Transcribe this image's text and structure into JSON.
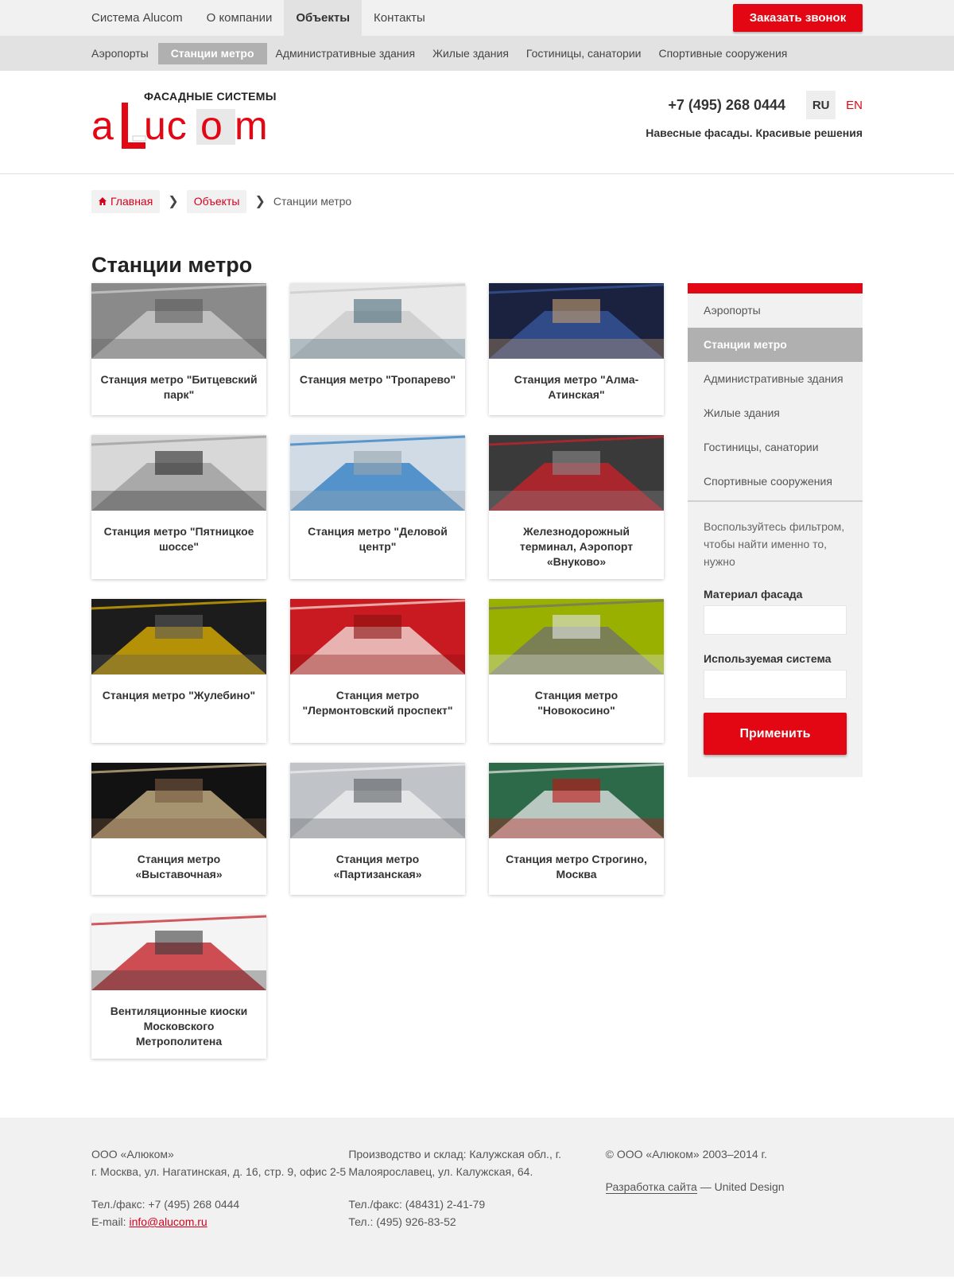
{
  "topnav": {
    "items": [
      {
        "label": "Система Alucom",
        "active": false
      },
      {
        "label": "О компании",
        "active": false
      },
      {
        "label": "Объекты",
        "active": true
      },
      {
        "label": "Контакты",
        "active": false
      }
    ],
    "call_button": "Заказать звонок"
  },
  "subnav": {
    "items": [
      {
        "label": "Аэропорты",
        "active": false
      },
      {
        "label": "Станции метро",
        "active": true
      },
      {
        "label": "Административные здания",
        "active": false
      },
      {
        "label": "Жилые здания",
        "active": false
      },
      {
        "label": "Гостиницы, санатории",
        "active": false
      },
      {
        "label": "Спортивные сооружения",
        "active": false
      }
    ]
  },
  "header": {
    "logo_subtitle": "ФАСАДНЫЕ СИСТЕМЫ",
    "logo_text": "aLucom",
    "phone": "+7 (495) 268 0444",
    "lang_ru": "RU",
    "lang_en": "EN",
    "slogan": "Навесные фасады. Красивые решения"
  },
  "breadcrumb": {
    "home": "Главная",
    "objects": "Объекты",
    "current": "Станции метро"
  },
  "page_title": "Станции метро",
  "cards": [
    {
      "title": "Станция метро \"Битцевский парк\"",
      "palette": [
        "#8a8a8a",
        "#d0d0d0",
        "#5c5c5c"
      ]
    },
    {
      "title": "Станция метро \"Тропарево\"",
      "palette": [
        "#e8e8e8",
        "#c9c9c9",
        "#4a6a7a"
      ]
    },
    {
      "title": "Станция метро \"Алма-Атинская\"",
      "palette": [
        "#1b2240",
        "#3a5aa0",
        "#c8a070"
      ]
    },
    {
      "title": "Станция метро \"Пятницкое шоссе\"",
      "palette": [
        "#d8d8d8",
        "#9a9a9a",
        "#2a2a2a"
      ]
    },
    {
      "title": "Станция метро \"Деловой центр\"",
      "palette": [
        "#d0dbe6",
        "#2a7ac0",
        "#9aa5ad"
      ]
    },
    {
      "title": "Железнодорожный терминал, Аэропорт «Внуково»",
      "palette": [
        "#3a3a3a",
        "#d0202a",
        "#8a8a8a"
      ]
    },
    {
      "title": "Станция метро \"Жулебино\"",
      "palette": [
        "#1c1c1c",
        "#e8b800",
        "#5a5a5a"
      ]
    },
    {
      "title": "Станция метро \"Лермонтовский проспект\"",
      "palette": [
        "#c81a20",
        "#f2e6e0",
        "#8a1010"
      ]
    },
    {
      "title": "Станция метро \"Новокосино\"",
      "palette": [
        "#9ab000",
        "#707070",
        "#dfe5e8"
      ]
    },
    {
      "title": "Станция метро «Выставочная»",
      "palette": [
        "#121212",
        "#d8c090",
        "#7a5a40"
      ]
    },
    {
      "title": "Станция метро «Партизанская»",
      "palette": [
        "#c0c4c8",
        "#f0f0f0",
        "#5a5e62"
      ]
    },
    {
      "title": "Станция метро Строгино, Москва",
      "palette": [
        "#2d6a4a",
        "#e8e8e8",
        "#c01010"
      ]
    },
    {
      "title": "Вентиляционные киоски Московского Метрополитена",
      "palette": [
        "#f4f4f4",
        "#c0161e",
        "#3a3a3a"
      ]
    }
  ],
  "sidebar": {
    "items": [
      {
        "label": "Аэропорты",
        "active": false
      },
      {
        "label": "Станции метро",
        "active": true
      },
      {
        "label": "Административные здания",
        "active": false
      },
      {
        "label": "Жилые здания",
        "active": false
      },
      {
        "label": "Гостиницы, санатории",
        "active": false
      },
      {
        "label": "Спортивные сооружения",
        "active": false
      }
    ],
    "hint": "Воспользуйтесь фильтром, чтобы найти именно то, нужно",
    "material_label": "Материал фасада",
    "system_label": "Используемая система",
    "apply_button": "Применить"
  },
  "footer": {
    "col1": {
      "company": "ООО «Алюком»",
      "address": "г. Москва, ул. Нагатинская, д. 16, стр. 9, офис 2-5",
      "phone": "Тел./факс: +7 (495) 268 0444",
      "email_label": "E-mail: ",
      "email": "info@alucom.ru"
    },
    "col2": {
      "production": "Производство и склад: Калужская обл., г. Малоярославец, ул. Калужская, 64.",
      "phone1": "Тел./факс: (48431) 2-41-79",
      "phone2": "Тел.: (495) 926-83-52"
    },
    "col3": {
      "copyright": "© ООО «Алюком» 2003–2014 г.",
      "dev_link": "Разработка сайта",
      "dev_rest": " — United Design"
    }
  },
  "colors": {
    "accent": "#e30613",
    "nav_bg": "#f1f1f1",
    "active_gray": "#b0b0b0"
  }
}
